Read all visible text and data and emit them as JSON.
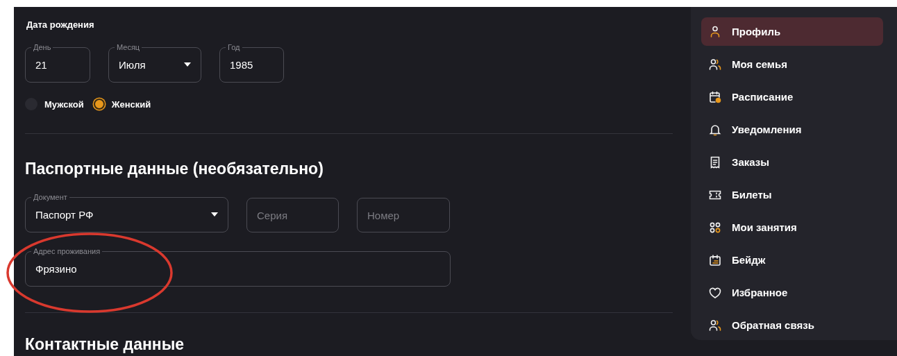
{
  "birth_date": {
    "title": "Дата рождения",
    "fields": [
      {
        "kind": "input",
        "label": "День",
        "value": "21"
      },
      {
        "kind": "select",
        "label": "Месяц",
        "value": "Июля"
      },
      {
        "kind": "input",
        "label": "Год",
        "value": "1985"
      }
    ]
  },
  "gender": [
    {
      "label": "Мужской",
      "selected": false
    },
    {
      "label": "Женский",
      "selected": true
    }
  ],
  "passport": {
    "title": "Паспортные данные (необязательно)",
    "fields": [
      {
        "kind": "select",
        "label": "Документ",
        "value": "Паспорт РФ"
      },
      {
        "kind": "input",
        "placeholder": "Серия"
      },
      {
        "kind": "input",
        "placeholder": "Номер"
      }
    ],
    "address": {
      "kind": "input",
      "label": "Адрес проживания",
      "value": "Фрязино"
    }
  },
  "contacts": {
    "title": "Контактные данные"
  },
  "sidebar": {
    "items": [
      {
        "label": "Профиль",
        "selected": true
      },
      {
        "label": "Моя семья",
        "selected": false
      },
      {
        "label": "Расписание",
        "selected": false
      },
      {
        "label": "Уведомления",
        "selected": false
      },
      {
        "label": "Заказы",
        "selected": false
      },
      {
        "label": "Билеты",
        "selected": false
      },
      {
        "label": "Мои занятия",
        "selected": false
      },
      {
        "label": "Бейдж",
        "selected": false
      },
      {
        "label": "Избранное",
        "selected": false
      },
      {
        "label": "Обратная связь",
        "selected": false
      }
    ]
  }
}
